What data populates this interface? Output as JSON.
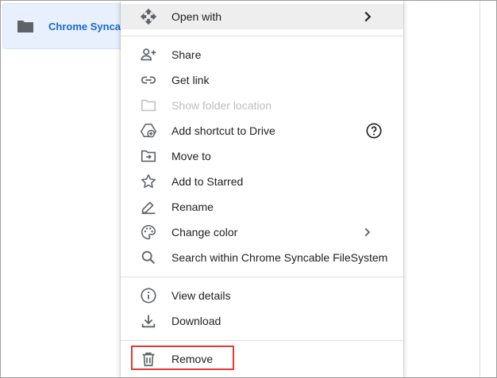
{
  "background": {
    "folder_name": "Chrome Syncable"
  },
  "menu": {
    "items": [
      {
        "label": "Open with",
        "icon": "open-with-icon",
        "trailing": "chevron-right-icon"
      },
      {
        "label": "Share",
        "icon": "person-add-icon"
      },
      {
        "label": "Get link",
        "icon": "link-icon"
      },
      {
        "label": "Show folder location",
        "icon": "folder-icon",
        "disabled": true
      },
      {
        "label": "Add shortcut to Drive",
        "icon": "add-shortcut-icon",
        "trailing": "help-icon"
      },
      {
        "label": "Move to",
        "icon": "move-to-folder-icon"
      },
      {
        "label": "Add to Starred",
        "icon": "star-icon"
      },
      {
        "label": "Rename",
        "icon": "pencil-icon"
      },
      {
        "label": "Change color",
        "icon": "palette-icon",
        "trailing": "chevron-right-icon"
      },
      {
        "label": "Search within Chrome Syncable FileSystem",
        "icon": "search-icon"
      },
      {
        "label": "View details",
        "icon": "info-icon"
      },
      {
        "label": "Download",
        "icon": "download-icon"
      },
      {
        "label": "Remove",
        "icon": "trash-icon"
      }
    ]
  },
  "colors": {
    "accent": "#1967d2",
    "highlight": "#e53935",
    "icon": "#5f6368",
    "hover": "#eeeeee"
  }
}
